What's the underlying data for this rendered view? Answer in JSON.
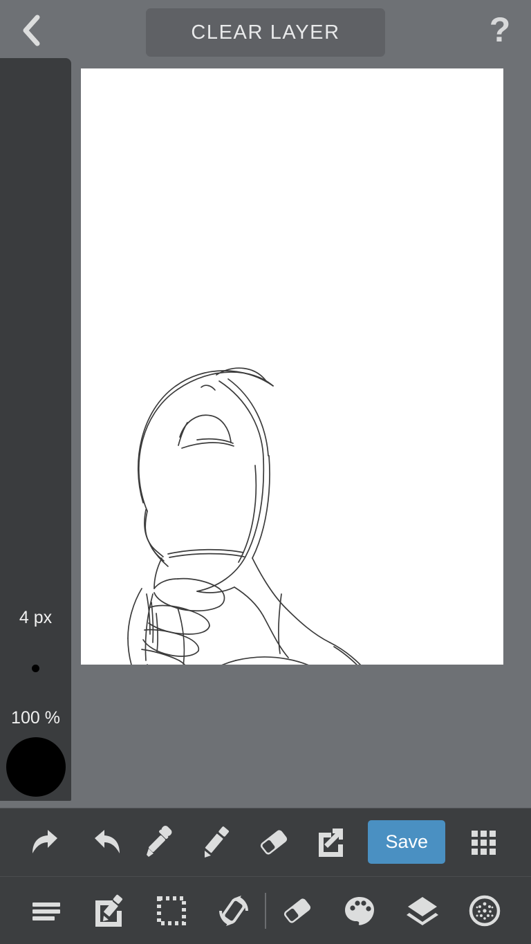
{
  "app": {
    "name": "drawing-app",
    "background_color": "#6e7175",
    "panel_color": "#3a3c3e",
    "accent_color": "#4a90c2",
    "canvas_color": "#ffffff"
  },
  "header": {
    "back_icon": "chevron-left-icon",
    "title": "CLEAR LAYER",
    "help_icon": "question-mark-icon",
    "help_label": "?"
  },
  "sidebar": {
    "brush_size": "4 px",
    "brush_preview_icon": "brush-size-dot",
    "opacity": "100 %",
    "color_swatch_icon": "color-swatch-circle",
    "color_swatch_value": "#000000"
  },
  "canvas": {
    "artwork_description": "pencil sketch of a person with hand resting at the chin",
    "stroke_color": "#3a3a3a"
  },
  "toolbar_top": {
    "items": [
      {
        "name": "undo-button",
        "icon": "undo-arrow-icon",
        "label": "Undo"
      },
      {
        "name": "redo-button",
        "icon": "redo-arrow-icon",
        "label": "Redo"
      },
      {
        "name": "eyedropper-button",
        "icon": "eyedropper-icon",
        "label": "Color Picker"
      },
      {
        "name": "pencil-button",
        "icon": "pencil-icon",
        "label": "Pencil"
      },
      {
        "name": "eraser-button",
        "icon": "eraser-icon",
        "label": "Eraser"
      },
      {
        "name": "export-button",
        "icon": "external-link-icon",
        "label": "Export"
      }
    ],
    "save_label": "Save",
    "grid_icon": "grid-apps-icon",
    "grid_label": "More"
  },
  "toolbar_bottom": {
    "items": [
      {
        "name": "menu-button",
        "icon": "hamburger-menu-icon",
        "label": "Menu"
      },
      {
        "name": "edit-button",
        "icon": "edit-square-pencil-icon",
        "label": "Edit"
      },
      {
        "name": "select-button",
        "icon": "selection-marquee-icon",
        "label": "Select"
      },
      {
        "name": "rotate-canvas-button",
        "icon": "rotate-canvas-icon",
        "label": "Rotate"
      }
    ],
    "items_right": [
      {
        "name": "eraser-tool-button",
        "icon": "eraser-icon",
        "label": "Eraser"
      },
      {
        "name": "palette-button",
        "icon": "palette-icon",
        "label": "Palette"
      },
      {
        "name": "layers-button",
        "icon": "layers-icon",
        "label": "Layers"
      },
      {
        "name": "brush-settings-button",
        "icon": "brush-texture-circle-icon",
        "label": "Brush"
      }
    ]
  }
}
